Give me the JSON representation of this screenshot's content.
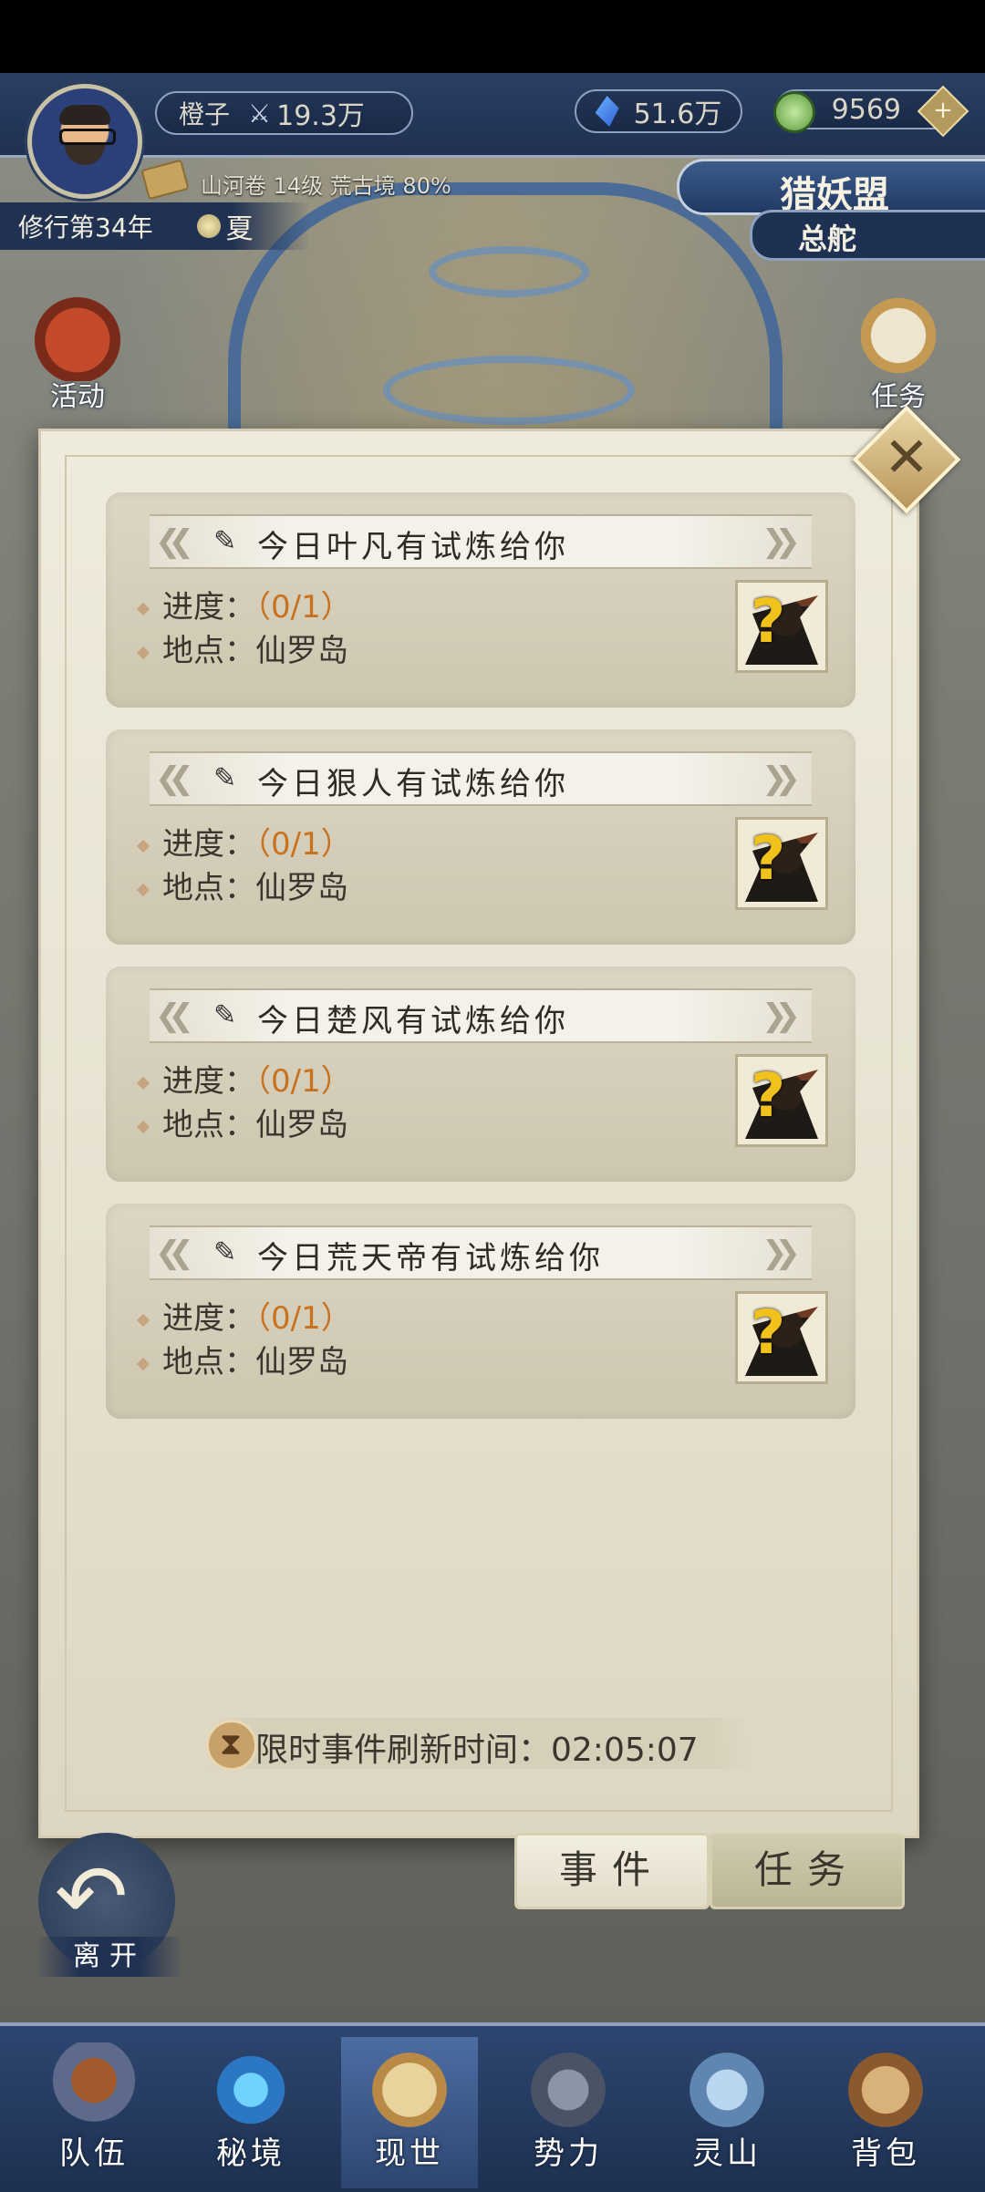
{
  "hud": {
    "player_name": "橙子",
    "power": "19.3万",
    "crystals": "51.6万",
    "jade": "9569",
    "plus_label": "+",
    "realm_info": "山河卷 14级 荒古境 80%",
    "cultivation_year": "修行第34年",
    "season": "夏",
    "league_title": "猎妖盟",
    "league_sub": "总舵"
  },
  "side_buttons": {
    "activity": "活动",
    "task": "任务"
  },
  "dialog": {
    "close_label": "✕",
    "progress_label": "进度：",
    "location_label": "地点：",
    "cards": [
      {
        "title": "今日叶凡有试炼给你",
        "progress": "（0/1）",
        "location": "仙罗岛"
      },
      {
        "title": "今日狠人有试炼给你",
        "progress": "（0/1）",
        "location": "仙罗岛"
      },
      {
        "title": "今日楚风有试炼给你",
        "progress": "（0/1）",
        "location": "仙罗岛"
      },
      {
        "title": "今日荒天帝有试炼给你",
        "progress": "（0/1）",
        "location": "仙罗岛"
      }
    ],
    "timer_text": "限时事件刷新时间：02:05:07"
  },
  "tabs": {
    "event": "事件",
    "task": "任务"
  },
  "leave_label": "离开",
  "nav": [
    "队伍",
    "秘境",
    "现世",
    "势力",
    "灵山",
    "背包"
  ],
  "colors": {
    "accent_orange": "#c8721f",
    "panel_bg": "#efebdc",
    "hud_blue": "#203152"
  }
}
